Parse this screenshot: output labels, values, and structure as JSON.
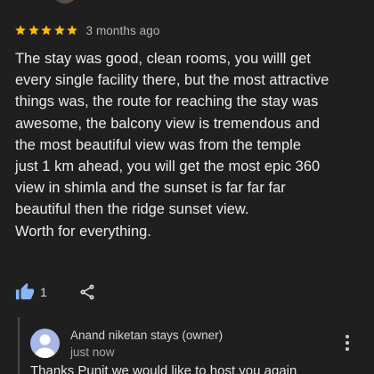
{
  "review": {
    "rating": 5,
    "rating_max": 5,
    "star_color": "#fbbc04",
    "timestamp": "3 months ago",
    "text": "The stay was good, clean rooms, you willl get\nevery single facility there, but the most attractive\nthings was, the route for reaching the stay was\nawesome, the balcony view is tremendous and\nthe most beautiful view was from the temple\njust 1 km ahead, you will get the most epic 360\nview in shimla and the sunset is far far far\nbeautiful then the ridge sunset view.\nWorth for everything.",
    "like_count": "1",
    "like_icon": "thumbs-up-icon",
    "like_icon_color": "#8ab4f8",
    "share_icon": "share-icon"
  },
  "owner_reply": {
    "name": "Anand niketan stays (owner)",
    "time": "just now",
    "text": "Thanks Punit we would like to host you again",
    "avatar_color": "#a9b7e8",
    "menu_icon": "more-vert-icon"
  }
}
